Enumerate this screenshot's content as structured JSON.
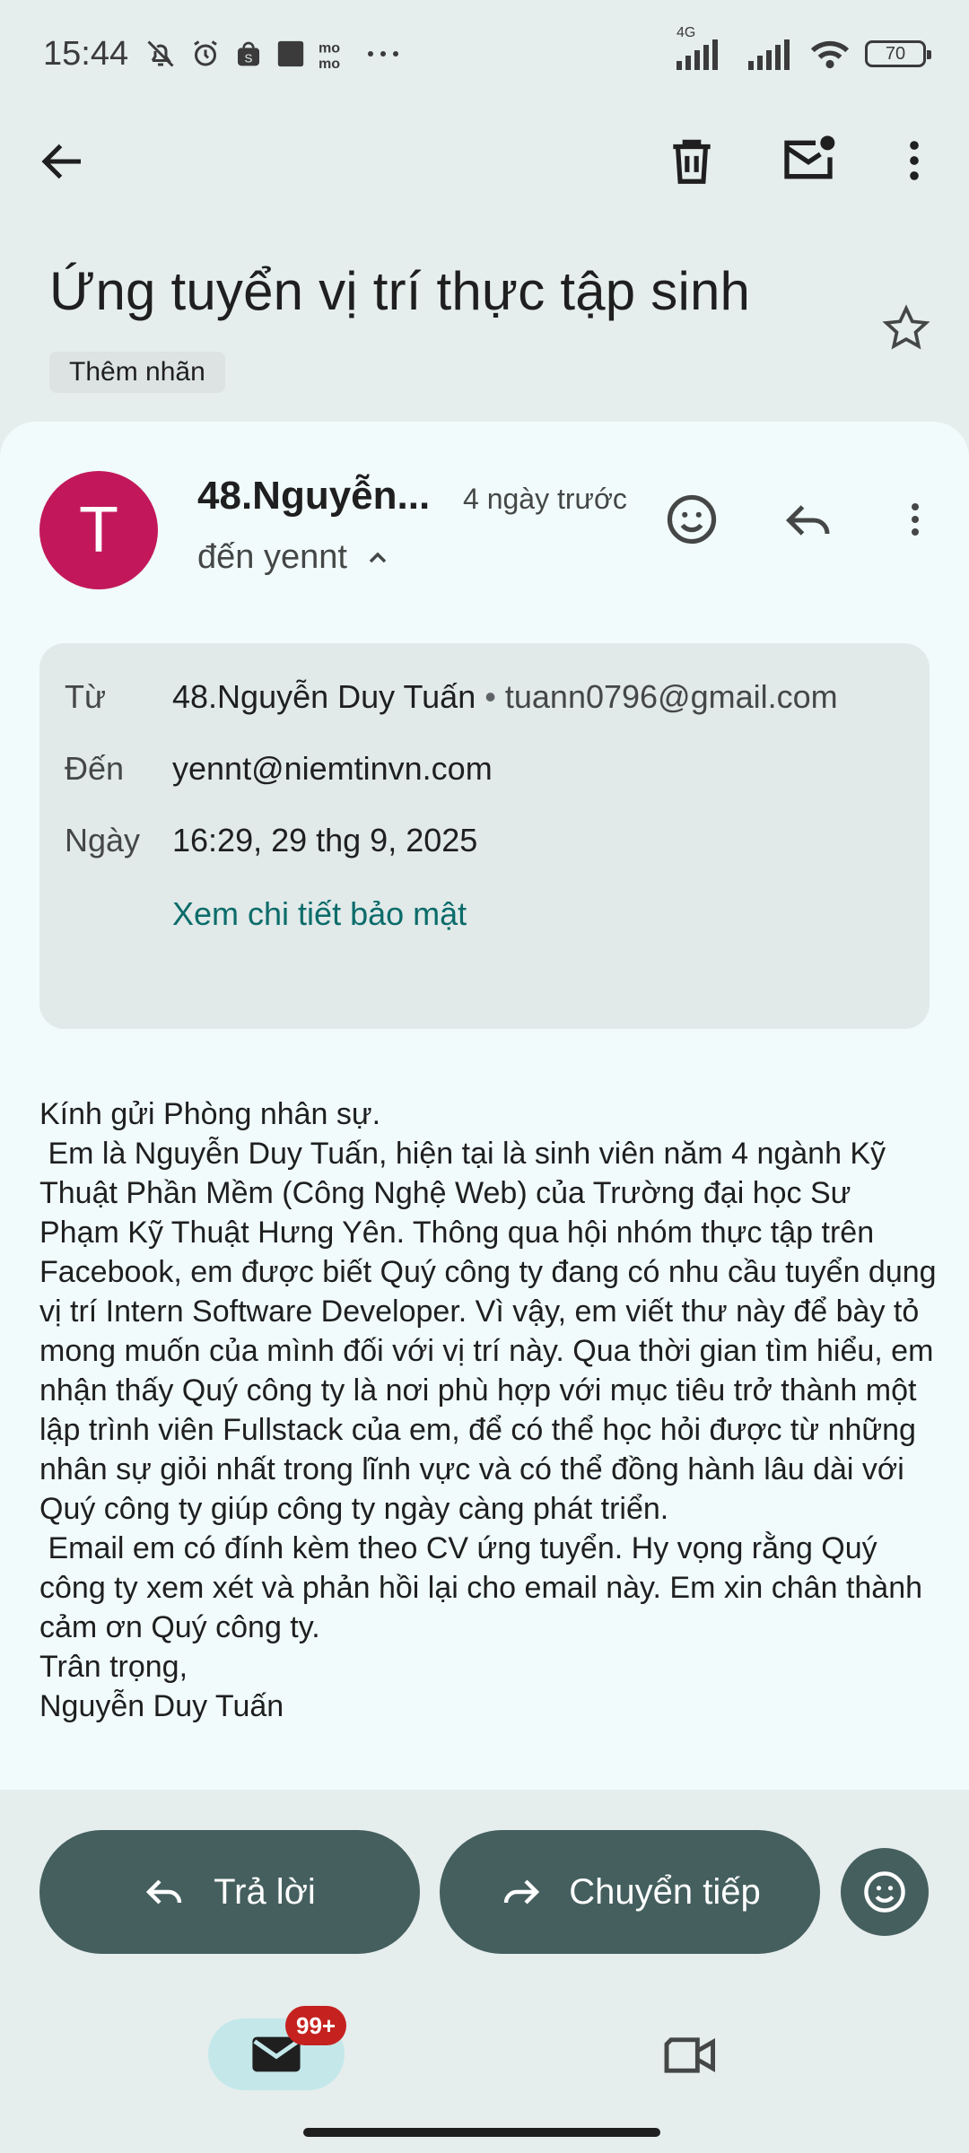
{
  "status_bar": {
    "time": "15:44",
    "network": "4G",
    "battery": "70",
    "icons": [
      "bell-off-icon",
      "alarm-icon",
      "shopee-icon",
      "square-icon",
      "momo-icon",
      "more-dots-icon",
      "signal-icon",
      "signal-icon",
      "wifi-icon",
      "battery-icon"
    ]
  },
  "toolbar": {
    "icons": [
      "back-arrow-icon",
      "delete-icon",
      "mark-unread-icon",
      "more-vert-icon"
    ]
  },
  "subject": "Ứng tuyển vị trí thực tập sinh",
  "label_chip": "Thêm nhãn",
  "message": {
    "avatar_letter": "T",
    "avatar_color": "#c2185b",
    "sender_short": "48.Nguyễn...",
    "sent_relative": "4 ngày trước",
    "to_line": "đến yennt",
    "details": {
      "from_label": "Từ",
      "from_name": "48.Nguyễn Duy Tuấn",
      "separator": "•",
      "from_email": "tuann0796@gmail.com",
      "to_label": "Đến",
      "to_value": "yennt@niemtinvn.com",
      "date_label": "Ngày",
      "date_value": "16:29, 29 thg 9, 2025",
      "security_link": "Xem chi tiết bảo mật"
    },
    "body": [
      "Kính gửi Phòng nhân sự.",
      " Em là Nguyễn Duy Tuấn, hiện tại là sinh viên năm 4 ngành Kỹ  Thuật Phần Mềm (Công Nghệ Web) của Trường đại học Sư Phạm Kỹ Thuật Hưng Yên. Thông qua hội nhóm thực tập trên Facebook, em được biết Quý công ty đang có nhu cầu tuyển dụng vị trí Intern Software Developer. Vì vậy, em viết thư này để bày tỏ mong muốn của mình đối với vị trí này. Qua thời gian tìm hiểu, em nhận thấy Quý công ty là nơi phù hợp với mục tiêu trở thành một lập trình viên Fullstack của em, để có thể học hỏi được từ những nhân sự giỏi nhất trong lĩnh vực và có thể đồng hành lâu dài với Quý công ty giúp công ty ngày càng phát triển.",
      " Email em có đính kèm theo CV ứng tuyển. Hy vọng rằng Quý công ty xem xét và phản hồi lại cho email này. Em xin chân thành cảm ơn Quý công ty.",
      "Trân trọng,",
      "Nguyễn Duy Tuấn"
    ]
  },
  "actions": {
    "reply": "Trả lời",
    "forward": "Chuyển tiếp"
  },
  "bottom_nav": {
    "mail_badge": "99+",
    "icons": [
      "mail-icon",
      "video-call-icon"
    ]
  },
  "colors": {
    "accent": "#455f5f",
    "link": "#0b6c6a",
    "badge": "#c5221f"
  }
}
